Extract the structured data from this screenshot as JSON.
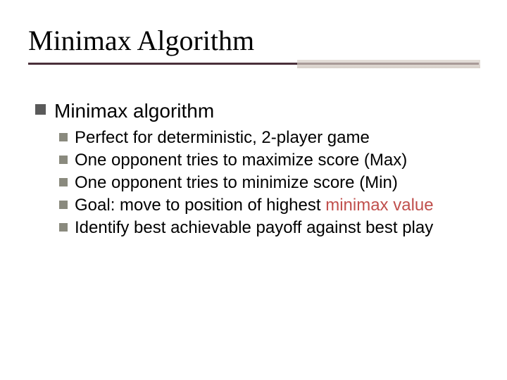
{
  "title": "Minimax Algorithm",
  "bullets": [
    {
      "text": "Minimax algorithm",
      "sub": [
        {
          "text": "Perfect for deterministic, 2-player game"
        },
        {
          "text": "One opponent tries to maximize score (Max)"
        },
        {
          "text": "One opponent tries to minimize score (Min)"
        },
        {
          "prefix": "Goal: move to position of highest ",
          "highlight": "minimax value"
        },
        {
          "text": "Identify best achievable payoff against best play"
        }
      ]
    }
  ]
}
